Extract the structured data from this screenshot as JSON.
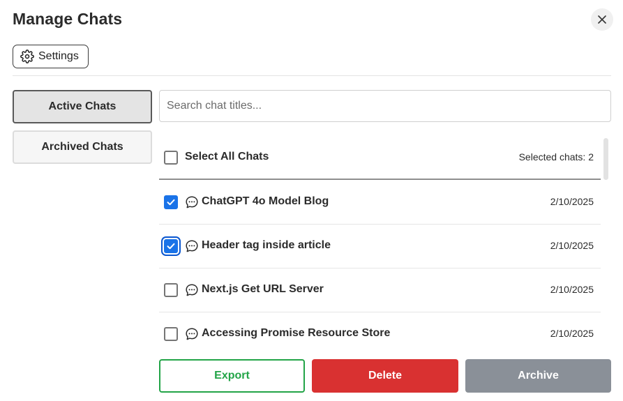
{
  "dialog": {
    "title": "Manage Chats",
    "settings_label": "Settings"
  },
  "sidebar": {
    "tabs": [
      {
        "label": "Active Chats",
        "active": true
      },
      {
        "label": "Archived Chats",
        "active": false
      }
    ]
  },
  "search": {
    "placeholder": "Search chat titles...",
    "value": ""
  },
  "list": {
    "select_all_label": "Select All Chats",
    "selected_count_text": "Selected chats: 2",
    "items": [
      {
        "title": "ChatGPT 4o Model Blog",
        "date": "2/10/2025",
        "checked": true
      },
      {
        "title": "Header tag inside article",
        "date": "2/10/2025",
        "checked": true
      },
      {
        "title": "Next.js Get URL Server",
        "date": "2/10/2025",
        "checked": false
      },
      {
        "title": "Accessing Promise Resource Store",
        "date": "2/10/2025",
        "checked": false
      }
    ]
  },
  "actions": {
    "export_label": "Export",
    "delete_label": "Delete",
    "archive_label": "Archive"
  },
  "colors": {
    "accent_blue": "#1a73e8",
    "export_green": "#22a447",
    "delete_red": "#d93131",
    "archive_gray": "#8a9098"
  },
  "icons": {
    "close": "close-icon",
    "settings": "gear-icon",
    "chat": "chat-bubble-icon",
    "check": "checkmark-icon"
  }
}
